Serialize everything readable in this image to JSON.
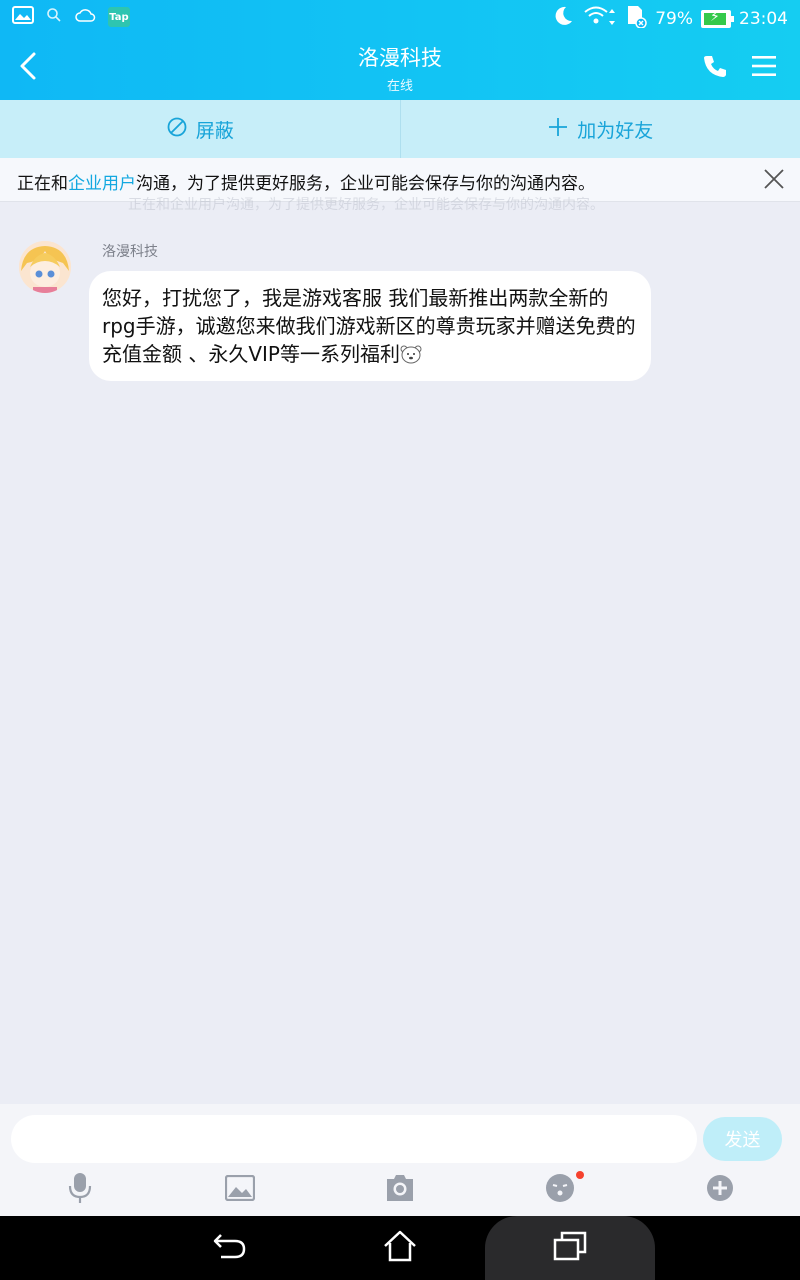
{
  "status_bar": {
    "icons_left": [
      "gallery-icon",
      "search-icon",
      "weather-icon",
      "tap-app-icon"
    ],
    "tap_label": "Tap",
    "icons_right": [
      "moon-icon",
      "wifi-icon",
      "sd-card-icon",
      "battery-icon"
    ],
    "battery": "79%",
    "battery_level": 0.79,
    "time": "23:04"
  },
  "header": {
    "title": "洛漫科技",
    "subtitle": "在线",
    "icons": [
      "back-icon",
      "phone-icon",
      "menu-icon"
    ]
  },
  "actions": {
    "block_label": "屏蔽",
    "add_friend_label": "加为好友"
  },
  "notice": {
    "prefix": "正在和",
    "link": "企业用户",
    "suffix": "沟通，为了提供更好服务，企业可能会保存与你的沟通内容。"
  },
  "messages": [
    {
      "sender": "洛漫科技",
      "text": "您好，打扰您了，我是游戏客服 我们最新推出两款全新的rpg手游，诚邀您来做我们游戏新区的尊贵玩家并赠送免费的充值金额 、永久VIP等一系列福利"
    }
  ],
  "composer": {
    "placeholder": "",
    "send_label": "发送",
    "tools": [
      "microphone-icon",
      "image-icon",
      "camera-icon",
      "emoji-icon",
      "plus-icon"
    ]
  },
  "colors": {
    "header": "#12c3f4",
    "accent": "#13a8e0",
    "action_bg": "#c7eef9",
    "chat_bg": "#ebedf5"
  }
}
